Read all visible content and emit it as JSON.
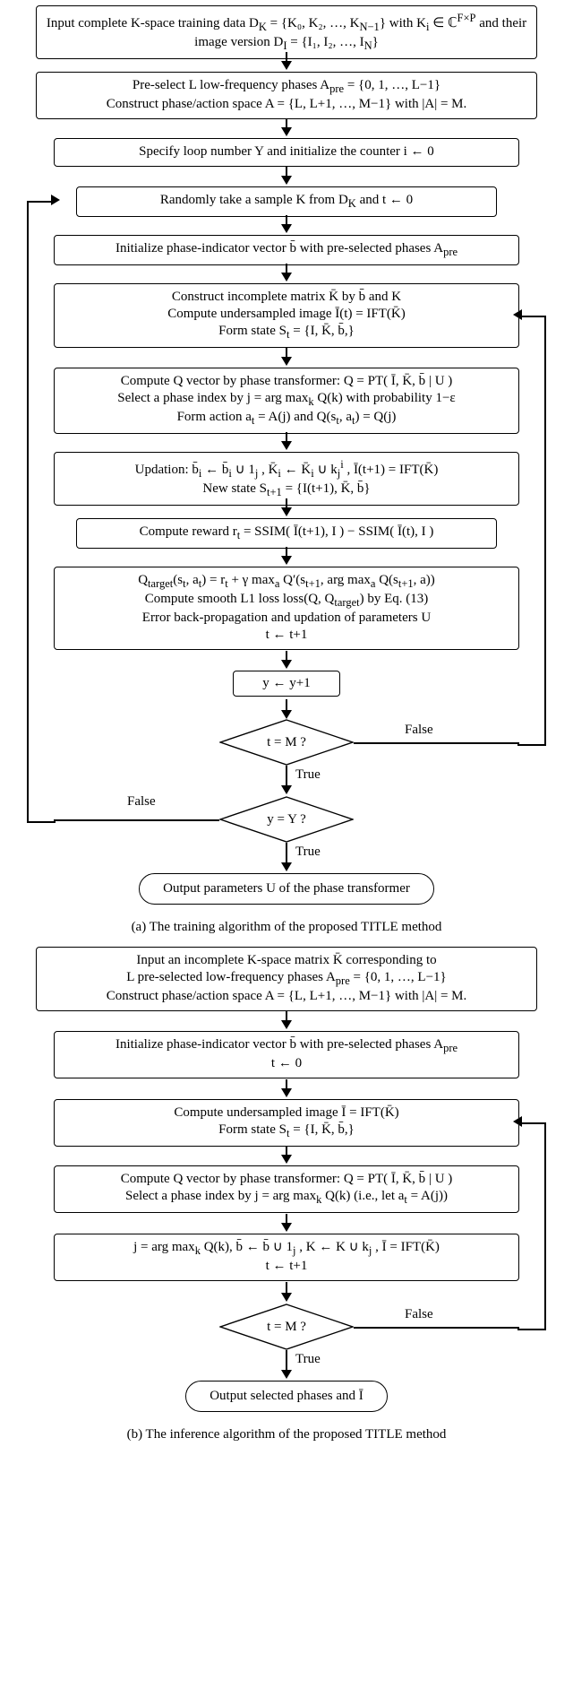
{
  "train": {
    "input": "Input complete K-space training data  D<sub>K</sub> = {K₀, K₂, …, K<sub>N−1</sub>}  with  K<sub>i</sub> ∈ ℂ<sup>F×P</sup>  and their image version  D<sub>I</sub> = {I₁, I₂, …, I<sub>N</sub>}",
    "preselect": "Pre-select  L  low-frequency phases  A<sub>pre</sub> = {0, 1, …, L−1}<br>Construct phase/action space  A = {L, L+1, …, M−1}  with |A| = M.",
    "loopinit": "Specify loop number Y and initialize the counter i ← 0",
    "sample": "Randomly take a sample  K  from  D<sub>K</sub>  and  t ← 0",
    "initb": "Initialize phase-indicator vector  b̄  with pre-selected phases A<sub>pre</sub>",
    "construct": "Construct incomplete matrix  K̄  by  b̄  and  K<br>Compute undersampled image  Ī(t) = IFT(K̄)<br>Form state  S<sub>t</sub> = {I, K̄, b̄,}",
    "qvec": "Compute Q vector by phase transformer:  Q = PT( Ī, K̄, b̄ | U )<br>Select a phase index by  j = arg max<sub>k</sub> Q(k)  with probability 1−ε<br>Form action  a<sub>t</sub> = A(j)  and  Q(s<sub>t</sub>, a<sub>t</sub>) = Q(j)",
    "update": "Updation:  b̄<sub>i</sub> ← b̄<sub>i</sub> ∪ 1<sub>j</sub> ,  K̄<sub>i</sub> ← K̄<sub>i</sub> ∪ k<sub>j</sub><sup>i</sup> ,  Ī(t+1) = IFT(K̄)<br>New state  S<sub>t+1</sub> = {I(t+1), K̄, b̄}",
    "reward": "Compute reward  r<sub>t</sub> = SSIM( Ī(t+1), I ) − SSIM( Ī(t), I )",
    "target": "Q<sub>target</sub>(s<sub>t</sub>, a<sub>t</sub>) = r<sub>t</sub> + γ max<sub>a</sub> Q′(s<sub>t+1</sub>, arg max<sub>a</sub> Q(s<sub>t+1</sub>, a))<br>Compute smooth L1 loss  loss(Q, Q<sub>target</sub>)  by Eq. (13)<br>Error back-propagation and updation of parameters U<br>t ← t+1",
    "yinc": "y ← y+1",
    "cond1": "t = M ?",
    "cond2": "y = Y ?",
    "true": "True",
    "false": "False",
    "output": "Output parameters U of the phase transformer",
    "caption": "(a) The training algorithm of the proposed TITLE method"
  },
  "infer": {
    "input": "Input an incomplete K-space matrix  K̄  corresponding to<br>L  pre-selected low-frequency phases  A<sub>pre</sub> = {0, 1, …, L−1}<br>Construct phase/action space  A = {L, L+1, …, M−1}  with |A| = M.",
    "initb": "Initialize phase-indicator vector  b̄  with pre-selected phases A<sub>pre</sub><br>t ← 0",
    "state": "Compute undersampled image  Ī = IFT(K̄)<br>Form state  S<sub>t</sub> = {I, K̄, b̄,}",
    "qvec": "Compute Q vector by phase transformer:  Q = PT( Ī, K̄, b̄ | U )<br>Select a phase index by  j = arg max<sub>k</sub> Q(k)  (i.e., let a<sub>t</sub> = A(j))",
    "update": "j = arg max<sub>k</sub> Q(k),  b̄ ← b̄ ∪ 1<sub>j</sub> ,  K ← K ∪ k<sub>j</sub> ,  Ī = IFT(K̄)<br>t ← t+1",
    "cond": "t = M ?",
    "true": "True",
    "false": "False",
    "output": "Output selected phases and Ī",
    "caption": "(b) The inference algorithm of the proposed TITLE method"
  }
}
